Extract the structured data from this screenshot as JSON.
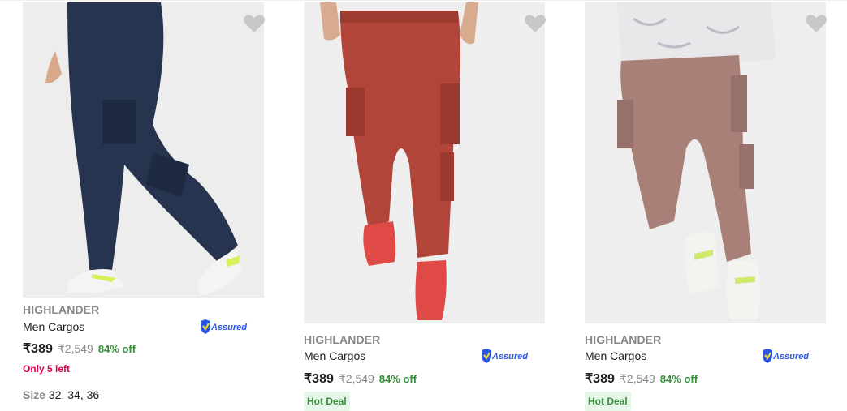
{
  "products": [
    {
      "image_alt": "Navy blue cargo joggers",
      "brand": "HIGHLANDER",
      "title": "Men Cargos",
      "assured_label": "Assured",
      "price": "₹389",
      "mrp": "₹2,549",
      "discount": "84% off",
      "stock_note": "Only 5 left",
      "size_label": "Size",
      "sizes": "32, 34, 36",
      "pant_color": "#26344f",
      "bg_color": "#ededed"
    },
    {
      "image_alt": "Rust red cargo joggers",
      "brand": "HIGHLANDER",
      "title": "Men Cargos",
      "assured_label": "Assured",
      "price": "₹389",
      "mrp": "₹2,549",
      "discount": "84% off",
      "badge": "Hot Deal",
      "pant_color": "#b2453a",
      "bg_color": "#efefef"
    },
    {
      "image_alt": "Mauve cargo joggers",
      "brand": "HIGHLANDER",
      "title": "Men Cargos",
      "assured_label": "Assured",
      "price": "₹389",
      "mrp": "₹2,549",
      "discount": "84% off",
      "badge": "Hot Deal",
      "pant_color": "#a98078",
      "bg_color": "#eeeeee"
    }
  ],
  "colors": {
    "brand_grey": "#878787",
    "discount_green": "#388e3c",
    "stock_pink": "#e5004f",
    "badge_bg": "#e6f7e9",
    "assured_blue": "#2a55e5"
  },
  "icons": {
    "wishlist": "heart-icon",
    "assured": "assured-badge-icon"
  }
}
